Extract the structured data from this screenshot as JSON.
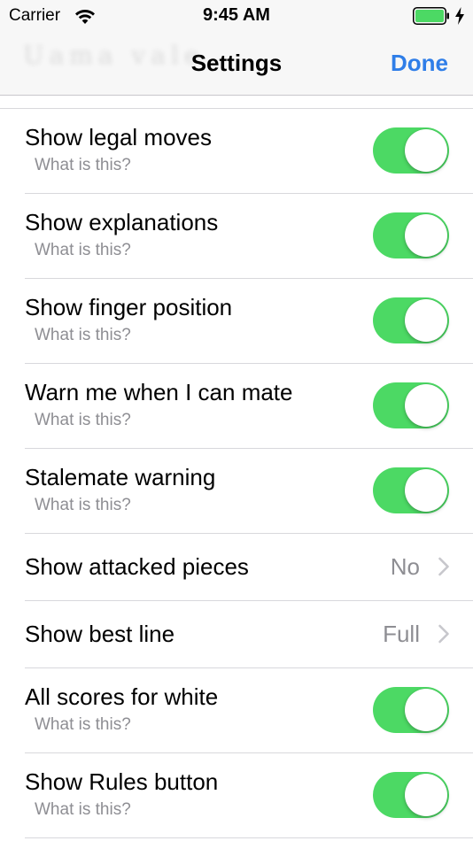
{
  "status_bar": {
    "carrier": "Carrier",
    "time": "9:45 AM",
    "battery_color": "#4cd964"
  },
  "nav": {
    "title": "Settings",
    "done_label": "Done",
    "ghost_text": "Uama vale"
  },
  "accent_color": "#2f7ee8",
  "toggle_on_color": "#4cd964",
  "settings": [
    {
      "label": "Show legal moves",
      "sub": "What is this?",
      "type": "toggle",
      "on": true
    },
    {
      "label": "Show explanations",
      "sub": "What is this?",
      "type": "toggle",
      "on": true
    },
    {
      "label": "Show finger position",
      "sub": "What is this?",
      "type": "toggle",
      "on": true
    },
    {
      "label": "Warn me when I can mate",
      "sub": "What is this?",
      "type": "toggle",
      "on": true
    },
    {
      "label": "Stalemate warning",
      "sub": "What is this?",
      "type": "toggle",
      "on": true
    },
    {
      "label": "Show attacked pieces",
      "type": "disclosure",
      "value": "No"
    },
    {
      "label": "Show best line",
      "type": "disclosure",
      "value": "Full"
    },
    {
      "label": "All scores for white",
      "sub": "What is this?",
      "type": "toggle",
      "on": true
    },
    {
      "label": "Show Rules button",
      "sub": "What is this?",
      "type": "toggle",
      "on": true
    }
  ]
}
